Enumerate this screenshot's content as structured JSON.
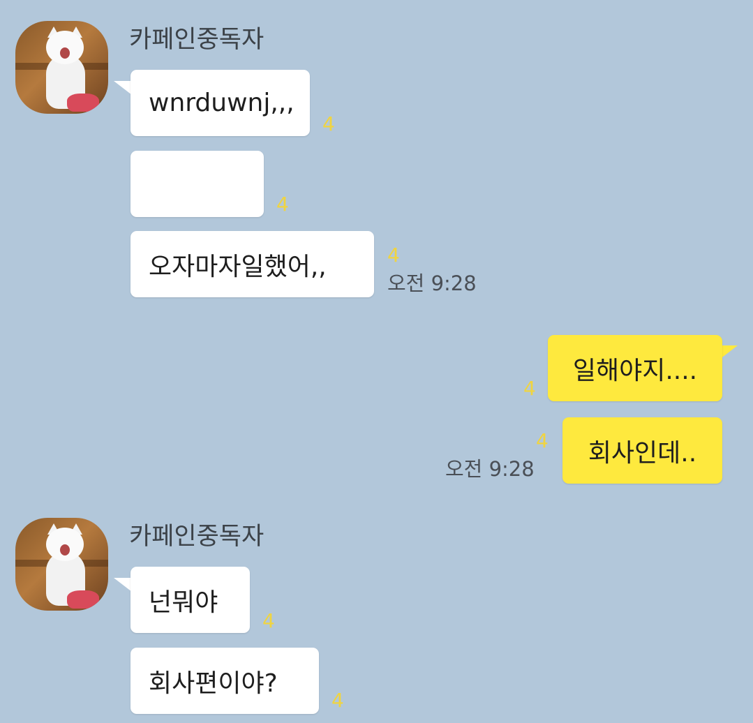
{
  "chat": {
    "groups": [
      {
        "sender": "카페인중독자",
        "messages": [
          {
            "text": "wnrduwnj,,,",
            "unread": "4"
          },
          {
            "text": "",
            "unread": "4"
          },
          {
            "text": "오자마자일했어,,",
            "unread": "4",
            "time": "오전 9:28"
          }
        ]
      },
      {
        "messages": [
          {
            "text": "일해야지....",
            "unread": "4"
          },
          {
            "text": "회사인데..",
            "unread": "4",
            "time": "오전 9:28"
          }
        ]
      },
      {
        "sender": "카페인중독자",
        "messages": [
          {
            "text": "넌뭐야",
            "unread": "4"
          },
          {
            "text": "회사편이야?",
            "unread": "4"
          }
        ]
      }
    ]
  },
  "colors": {
    "background": "#b2c7da",
    "incoming_bubble": "#ffffff",
    "outgoing_bubble": "#fee93e",
    "unread_count": "#f0d440"
  },
  "icons": {
    "avatar": "profile-cat-photo"
  }
}
